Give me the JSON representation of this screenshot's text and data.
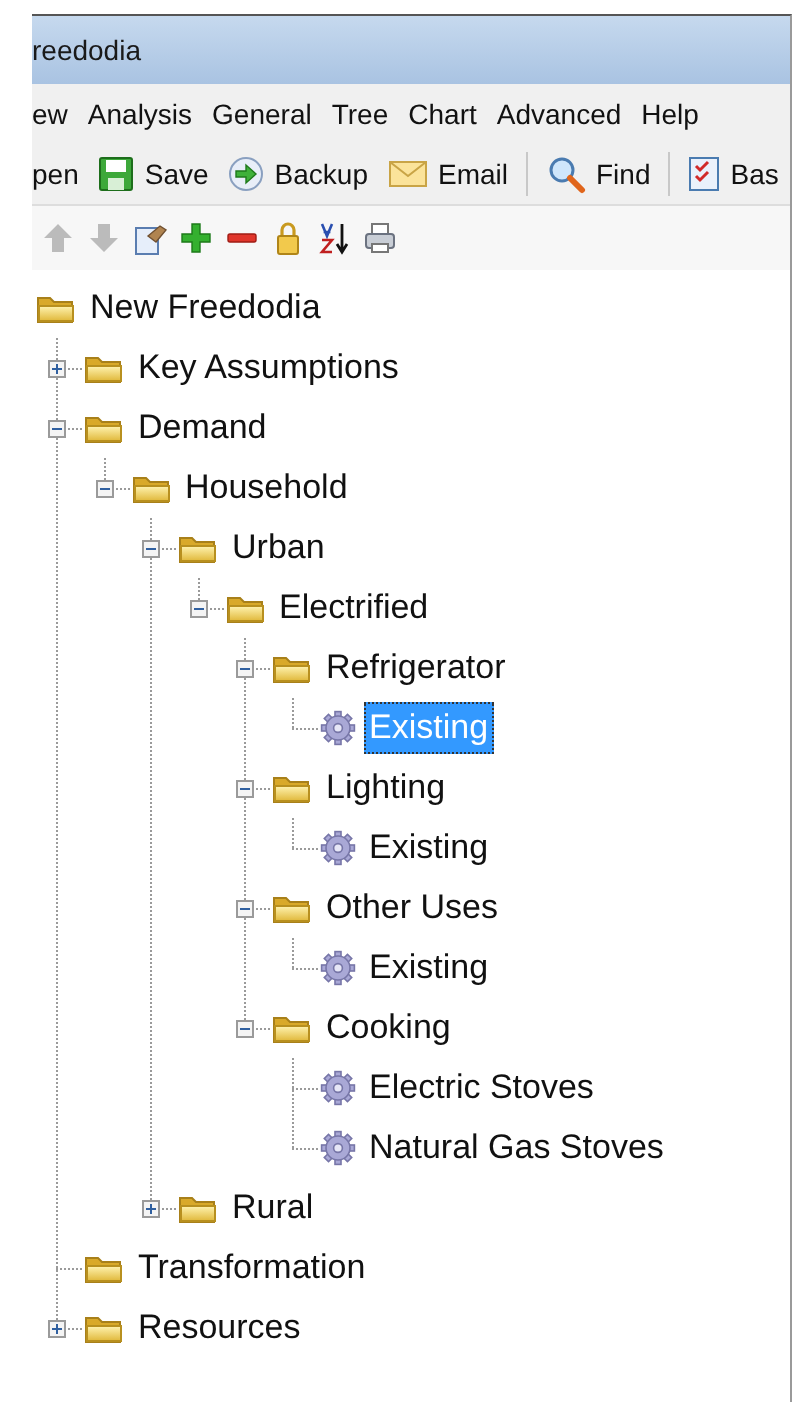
{
  "window": {
    "title": "reedodia"
  },
  "menu": [
    "ew",
    "Analysis",
    "General",
    "Tree",
    "Chart",
    "Advanced",
    "Help"
  ],
  "toolbar": [
    {
      "label": "pen"
    },
    {
      "label": "Save"
    },
    {
      "label": "Backup"
    },
    {
      "label": "Email"
    },
    {
      "label": "Find"
    },
    {
      "label": "Bas"
    }
  ],
  "tree_toolbar": [
    {
      "disabled": true
    },
    {
      "disabled": true
    },
    {
      "disabled": false
    },
    {
      "disabled": false
    },
    {
      "disabled": false
    },
    {
      "disabled": false
    },
    {
      "disabled": false
    },
    {
      "disabled": false
    }
  ],
  "tree": {
    "label": "New Freedodia",
    "kind": "folder",
    "selected": false,
    "children": [
      {
        "label": "Key Assumptions",
        "kind": "folder",
        "selected": false,
        "expanded": false
      },
      {
        "label": "Demand",
        "kind": "folder",
        "selected": false,
        "expanded": true,
        "children": [
          {
            "label": "Household",
            "kind": "folder",
            "selected": false,
            "expanded": true,
            "children": [
              {
                "label": "Urban",
                "kind": "folder",
                "selected": false,
                "expanded": true,
                "children": [
                  {
                    "label": "Electrified",
                    "kind": "folder",
                    "selected": false,
                    "expanded": true,
                    "children": [
                      {
                        "label": "Refrigerator",
                        "kind": "folder",
                        "selected": false,
                        "expanded": true,
                        "children": [
                          {
                            "label": "Existing",
                            "kind": "leaf",
                            "selected": true
                          }
                        ]
                      },
                      {
                        "label": "Lighting",
                        "kind": "folder",
                        "selected": false,
                        "expanded": true,
                        "children": [
                          {
                            "label": "Existing",
                            "kind": "leaf",
                            "selected": false
                          }
                        ]
                      },
                      {
                        "label": "Other Uses",
                        "kind": "folder",
                        "selected": false,
                        "expanded": true,
                        "children": [
                          {
                            "label": "Existing",
                            "kind": "leaf",
                            "selected": false
                          }
                        ]
                      },
                      {
                        "label": "Cooking",
                        "kind": "folder",
                        "selected": false,
                        "expanded": true,
                        "children": [
                          {
                            "label": "Electric Stoves",
                            "kind": "leaf",
                            "selected": false
                          },
                          {
                            "label": "Natural Gas Stoves",
                            "kind": "leaf",
                            "selected": false
                          }
                        ]
                      }
                    ]
                  }
                ]
              },
              {
                "label": "Rural",
                "kind": "folder",
                "selected": false,
                "expanded": false
              }
            ]
          }
        ]
      },
      {
        "label": "Transformation",
        "kind": "folder",
        "selected": false
      },
      {
        "label": "Resources",
        "kind": "folder",
        "selected": false,
        "expanded": false
      }
    ]
  }
}
